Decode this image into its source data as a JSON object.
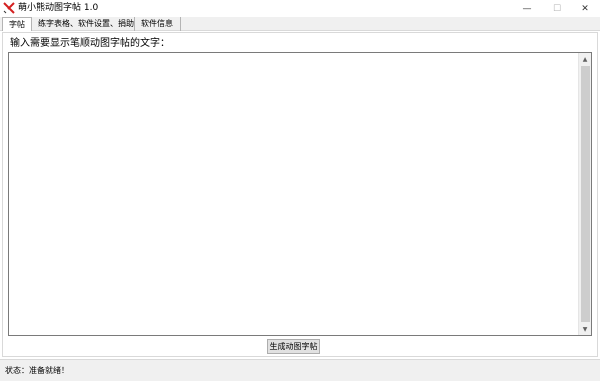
{
  "window": {
    "title": "萌小熊动图字帖 1.0",
    "icon": "red-x-logo-icon",
    "controls": {
      "minimize": "—",
      "maximize": "☐",
      "close": "✕"
    }
  },
  "tabs": [
    {
      "label": "字帖",
      "active": true
    },
    {
      "label": "练字表格、软件设置、捐助",
      "active": false
    },
    {
      "label": "软件信息",
      "active": false
    }
  ],
  "main": {
    "prompt_label": "输入需要显示笔顺动图字帖的文字：",
    "text_value": "",
    "generate_button": "生成动图字帖"
  },
  "status": {
    "text": "状态：准备就绪！"
  },
  "colors": {
    "logo_red": "#d42020",
    "chrome_gray": "#f0f0f0",
    "border": "#7a7a7a"
  }
}
